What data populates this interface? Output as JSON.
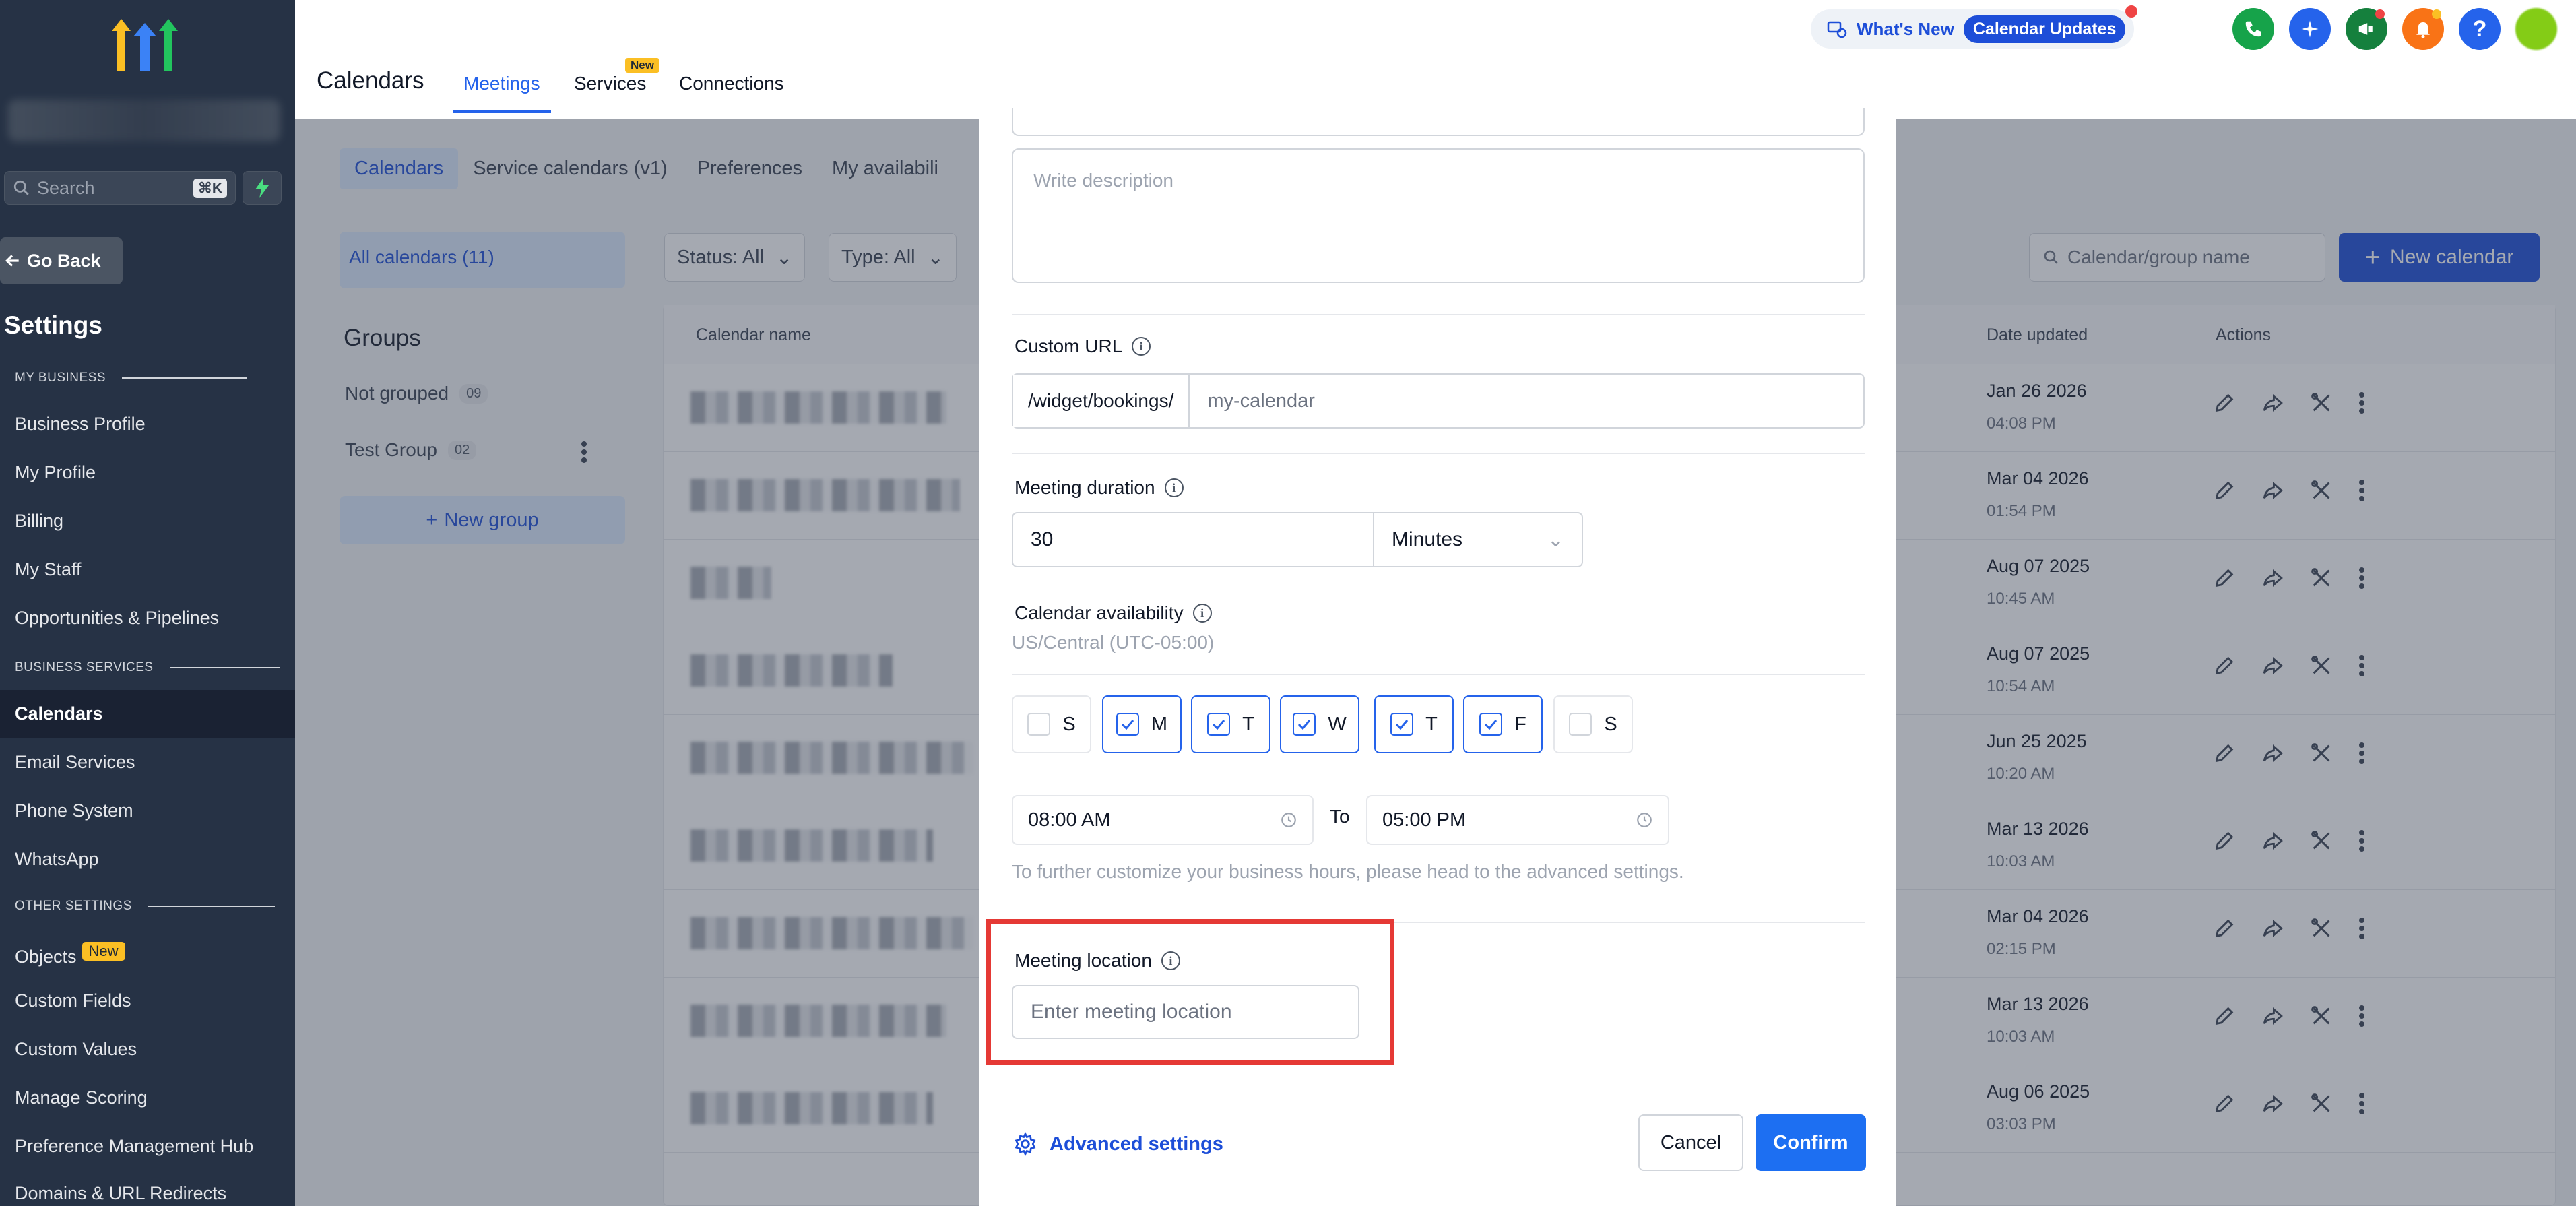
{
  "sidebar": {
    "search_placeholder": "Search",
    "search_shortcut": "⌘K",
    "go_back": "Go Back",
    "title": "Settings",
    "sections": {
      "my_business": "MY BUSINESS",
      "business_services": "BUSINESS SERVICES",
      "other_settings": "OTHER SETTINGS"
    },
    "items": {
      "business_profile": "Business Profile",
      "my_profile": "My Profile",
      "billing": "Billing",
      "my_staff": "My Staff",
      "opportunities": "Opportunities & Pipelines",
      "calendars": "Calendars",
      "email_services": "Email Services",
      "phone_system": "Phone System",
      "whatsapp": "WhatsApp",
      "objects": "Objects",
      "objects_badge": "New",
      "custom_fields": "Custom Fields",
      "custom_values": "Custom Values",
      "manage_scoring": "Manage Scoring",
      "preference_hub": "Preference Management Hub",
      "domains": "Domains & URL Redirects"
    }
  },
  "topbar": {
    "title": "Calendars",
    "tabs": {
      "meetings": "Meetings",
      "services": "Services",
      "services_badge": "New",
      "connections": "Connections"
    },
    "whats_new": "What's New",
    "calendar_updates": "Calendar Updates"
  },
  "main": {
    "subtabs": {
      "calendars": "Calendars",
      "service_calendars": "Service calendars (v1)",
      "preferences": "Preferences",
      "availability": "My availabili"
    },
    "all_calendars": "All calendars (11)",
    "groups_title": "Groups",
    "groups": [
      {
        "name": "Not grouped",
        "count": "09"
      },
      {
        "name": "Test Group",
        "count": "02"
      }
    ],
    "new_group": "New group",
    "filters": {
      "status": "Status: All",
      "type": "Type: All"
    },
    "search_placeholder": "Calendar/group name",
    "new_calendar": "New calendar",
    "columns": {
      "name": "Calendar name",
      "date_updated": "Date updated",
      "actions": "Actions"
    },
    "rows": [
      {
        "date": "Jan 26 2026",
        "time": "04:08 PM"
      },
      {
        "date": "Mar 04 2026",
        "time": "01:54 PM"
      },
      {
        "date": "Aug 07 2025",
        "time": "10:45 AM"
      },
      {
        "date": "Aug 07 2025",
        "time": "10:54 AM"
      },
      {
        "date": "Jun 25 2025",
        "time": "10:20 AM"
      },
      {
        "date": "Mar 13 2026",
        "time": "10:03 AM"
      },
      {
        "date": "Mar 04 2026",
        "time": "02:15 PM"
      },
      {
        "date": "Mar 13 2026",
        "time": "10:03 AM"
      },
      {
        "date": "Aug 06 2025",
        "time": "03:03 PM"
      }
    ]
  },
  "modal": {
    "description_placeholder": "Write description",
    "custom_url_label": "Custom URL",
    "url_prefix": "/widget/bookings/",
    "url_placeholder": "my-calendar",
    "duration_label": "Meeting duration",
    "duration_value": "30",
    "duration_unit": "Minutes",
    "availability_label": "Calendar availability",
    "timezone": "US/Central (UTC-05:00)",
    "days": [
      {
        "label": "S",
        "checked": false
      },
      {
        "label": "M",
        "checked": true
      },
      {
        "label": "T",
        "checked": true
      },
      {
        "label": "W",
        "checked": true
      },
      {
        "label": "T",
        "checked": true
      },
      {
        "label": "F",
        "checked": true
      },
      {
        "label": "S",
        "checked": false
      }
    ],
    "start_time": "08:00 AM",
    "to_label": "To",
    "end_time": "05:00 PM",
    "hours_hint": "To further customize your business hours, please head to the advanced settings.",
    "location_label": "Meeting location",
    "location_placeholder": "Enter meeting location",
    "advanced_settings": "Advanced settings",
    "cancel": "Cancel",
    "confirm": "Confirm"
  },
  "colors": {
    "accent": "#1d4ed8",
    "highlight": "#e53935",
    "sidebar": "#263245"
  }
}
